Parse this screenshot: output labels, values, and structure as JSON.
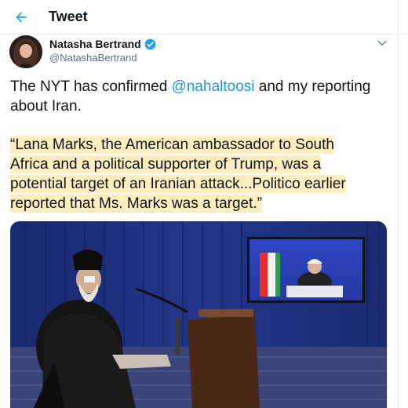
{
  "header": {
    "title": "Tweet",
    "back_icon": "arrow-left-icon"
  },
  "author": {
    "display_name": "Natasha Bertrand",
    "handle": "@NatashaBertrand",
    "verified": true
  },
  "tweet": {
    "text_before": "The NYT has confirmed ",
    "mention": "@nahaltoosi",
    "text_after": " and my reporting about Iran.",
    "quote_lines": [
      "“Lana Marks, the American ambassador to South",
      "Africa and a political supporter of Trump, was a",
      "potential target of an Iranian attack...Politico earlier",
      "reported that Ms. Marks was a target.”"
    ]
  },
  "colors": {
    "accent": "#1b95e0",
    "highlight": "#fdedbf",
    "verified": "#1da1f2"
  }
}
